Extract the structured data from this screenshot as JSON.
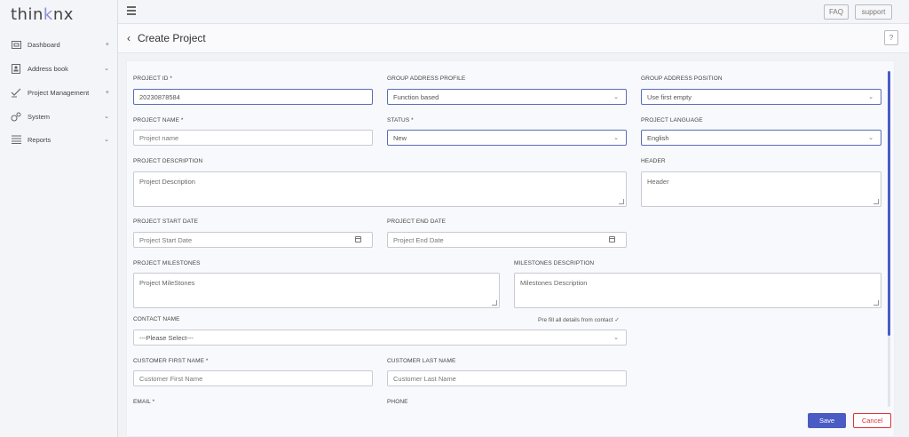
{
  "brand": {
    "logo_pre": "thin",
    "logo_accent": "k",
    "logo_post": "nx"
  },
  "sidebar": {
    "items": [
      {
        "label": "Dashboard",
        "icon": "dashboard-icon",
        "chevron": "+"
      },
      {
        "label": "Address book",
        "icon": "address-book-icon",
        "chevron": "⌄"
      },
      {
        "label": "Project Management",
        "icon": "project-management-icon",
        "chevron": "+"
      },
      {
        "label": "System",
        "icon": "gears-icon",
        "chevron": "⌄"
      },
      {
        "label": "Reports",
        "icon": "reports-icon",
        "chevron": "⌄"
      }
    ]
  },
  "topbar": {
    "faq_label": "FAQ",
    "support_label": "support"
  },
  "page": {
    "back_glyph": "‹",
    "title": "Create Project",
    "help_label": "?"
  },
  "form": {
    "project_id": {
      "label": "PROJECT ID *",
      "value": "20230878584"
    },
    "group_address_profile": {
      "label": "GROUP ADDRESS PROFILE",
      "value": "Function based"
    },
    "group_address_position": {
      "label": "GROUP ADDRESS POSITION",
      "value": "Use first empty"
    },
    "project_name": {
      "label": "PROJECT NAME *",
      "placeholder": "Project name"
    },
    "status": {
      "label": "STATUS *",
      "value": "New"
    },
    "project_language": {
      "label": "PROJECT LANGUAGE",
      "value": "English"
    },
    "project_description": {
      "label": "PROJECT DESCRIPTION",
      "placeholder": "Project Description"
    },
    "header": {
      "label": "HEADER",
      "placeholder": "Header"
    },
    "project_start_date": {
      "label": "PROJECT START DATE",
      "placeholder": "Project Start Date"
    },
    "project_end_date": {
      "label": "PROJECT END DATE",
      "placeholder": "Project End Date"
    },
    "project_milestones": {
      "label": "PROJECT MILESTONES",
      "placeholder": "Project MileStones"
    },
    "milestones_description": {
      "label": "MILESTONES DESCRIPTION",
      "placeholder": "Milestones Description"
    },
    "contact_name": {
      "label": "CONTACT NAME",
      "value": "---Please Select---",
      "prefill_label": "Pre fill all details from contact ✓"
    },
    "customer_first_name": {
      "label": "CUSTOMER FIRST NAME *",
      "placeholder": "Customer First Name"
    },
    "customer_last_name": {
      "label": "CUSTOMER LAST NAME",
      "placeholder": "Customer Last Name"
    },
    "email": {
      "label": "EMAIL *"
    },
    "phone": {
      "label": "PHONE"
    }
  },
  "actions": {
    "save_label": "Save",
    "cancel_label": "Cancel"
  },
  "colors": {
    "accent": "#4b5bc4",
    "danger": "#dd3333"
  }
}
